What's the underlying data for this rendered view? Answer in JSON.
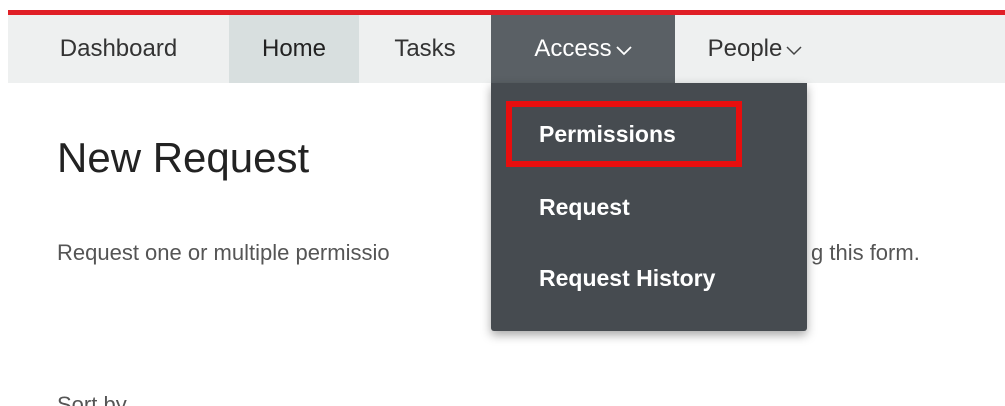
{
  "nav": {
    "items": [
      {
        "label": "Dashboard"
      },
      {
        "label": "Home"
      },
      {
        "label": "Tasks"
      },
      {
        "label": "Access"
      },
      {
        "label": "People"
      }
    ],
    "accent_color": "#e01f26",
    "active_color": "#5a6065"
  },
  "dropdown": {
    "items": [
      {
        "label": "Permissions"
      },
      {
        "label": "Request"
      },
      {
        "label": "Request History"
      }
    ],
    "background": "#464b50",
    "highlight_color": "#e80e0e"
  },
  "main": {
    "title": "New Request",
    "description_start": "Request one or multiple permissio",
    "description_end": "g this form.",
    "sort_label": "Sort by"
  }
}
